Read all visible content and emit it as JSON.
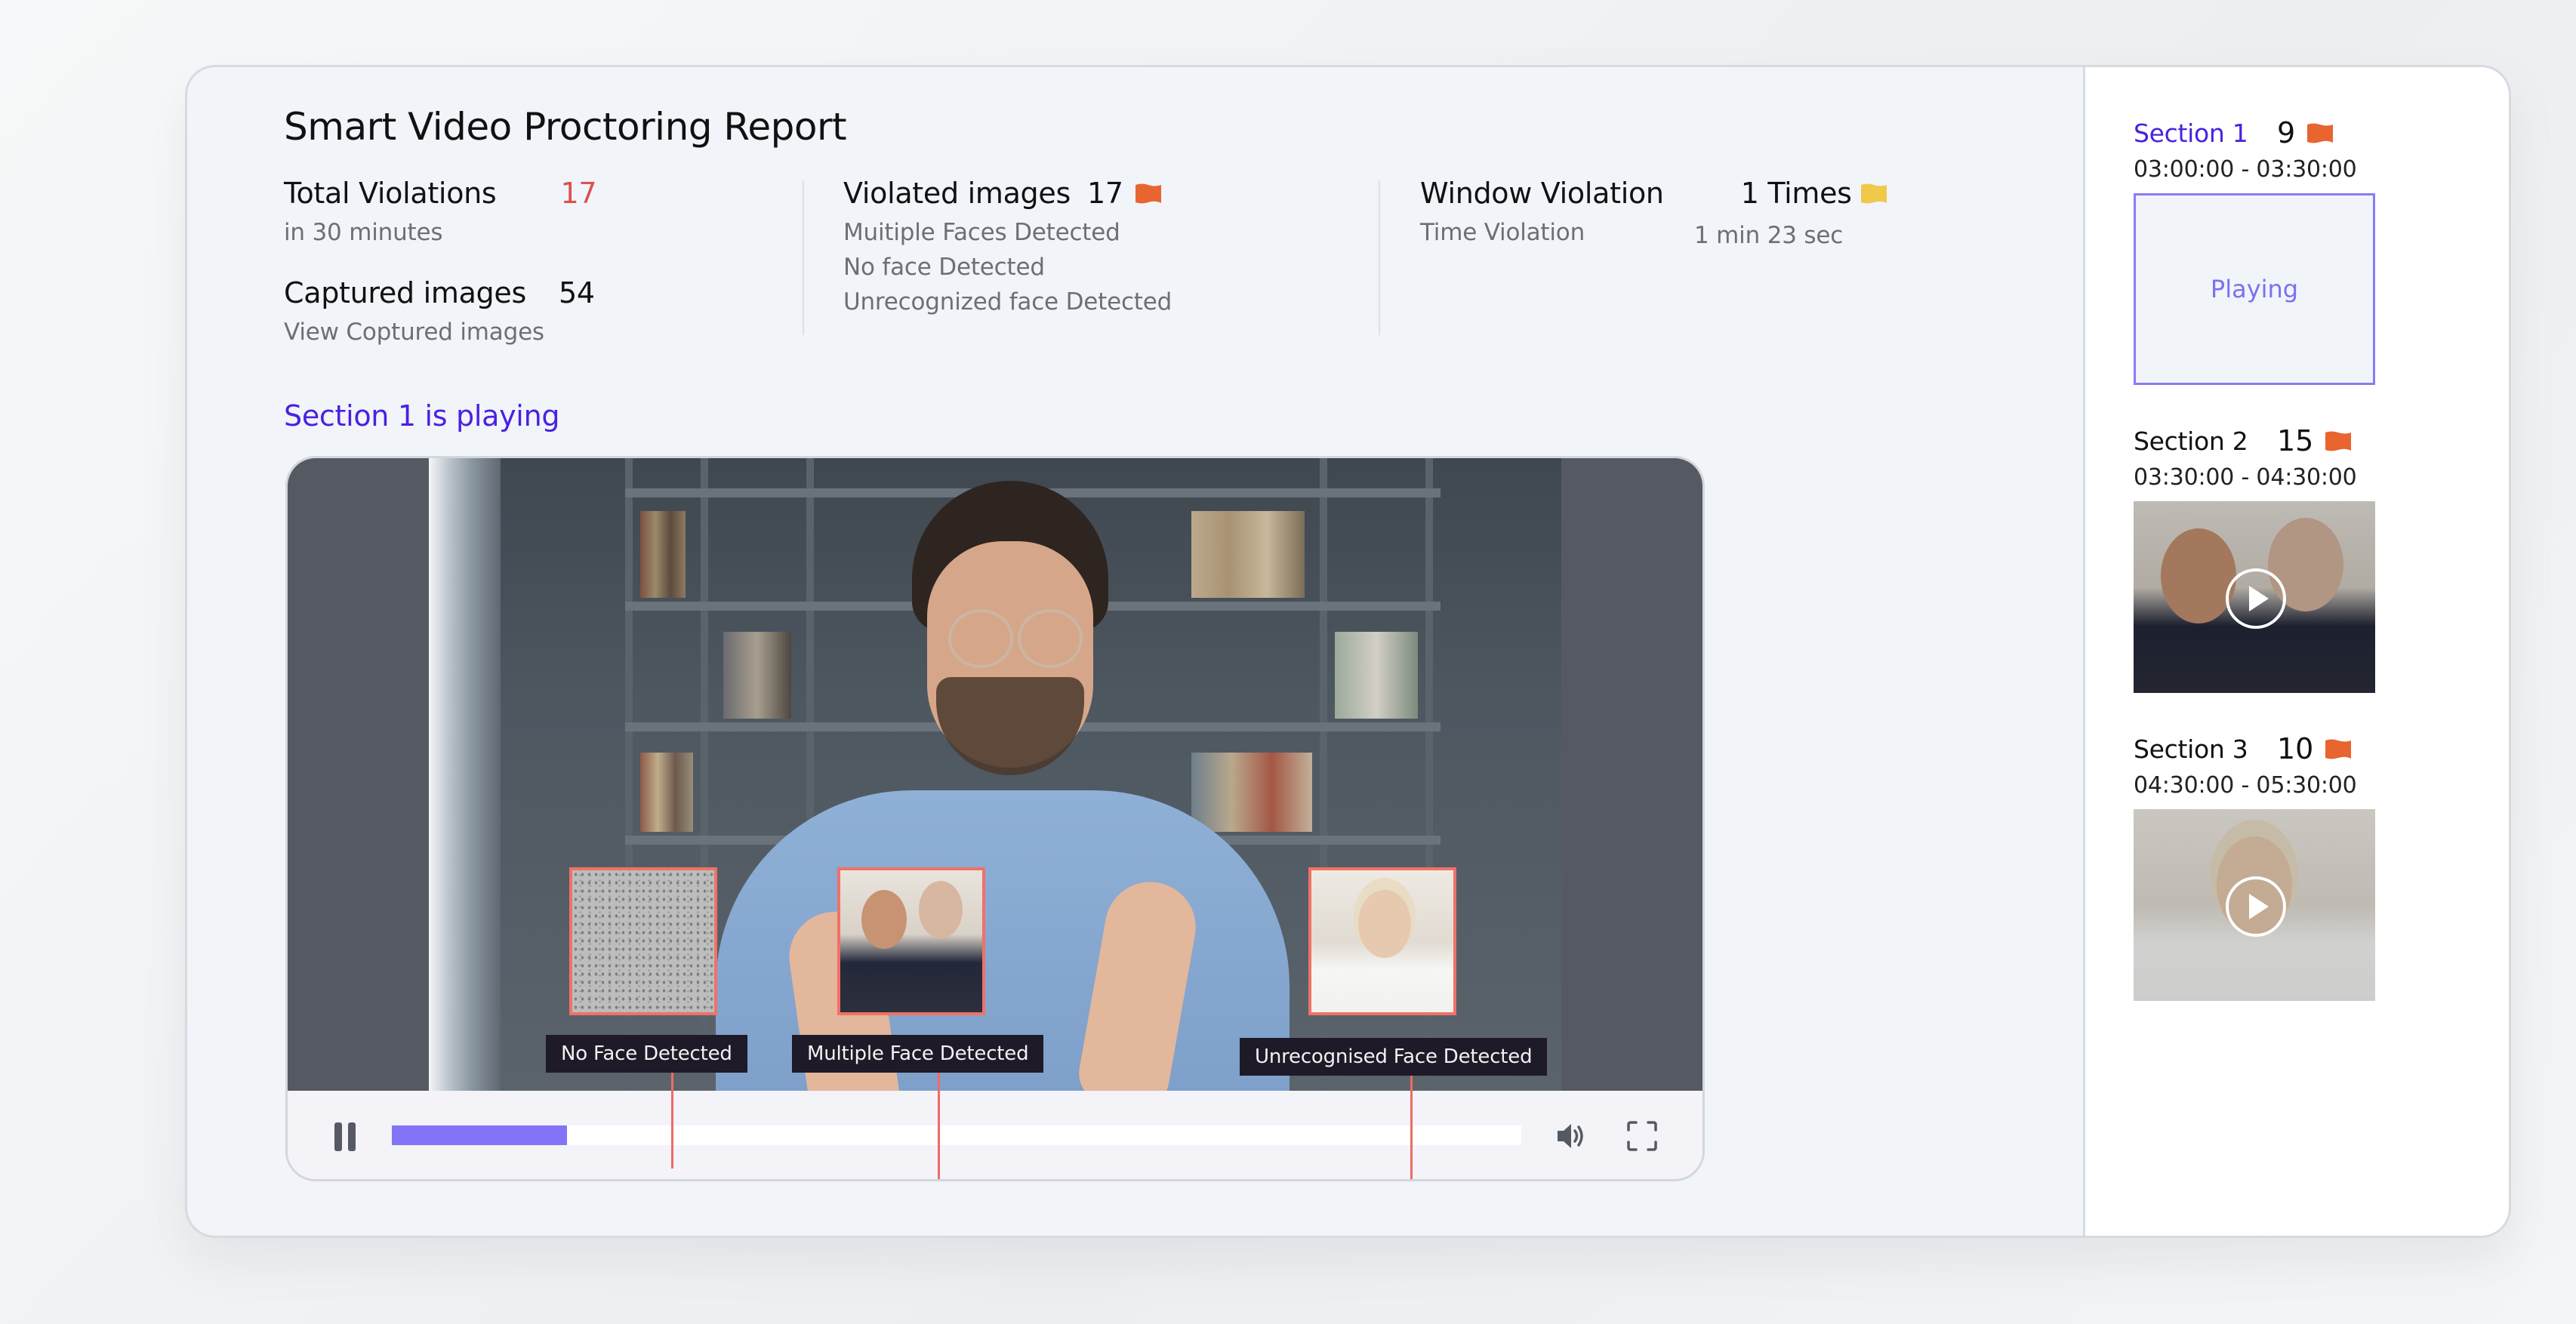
{
  "report": {
    "title": "Smart Video Proctoring Report",
    "total_violations": {
      "label": "Total Violations",
      "value": "17",
      "sub": "in 30 minutes"
    },
    "captured_images": {
      "label": "Captured images",
      "value": "54",
      "link": "View Coptured images"
    },
    "violated_images": {
      "label": "Violated images",
      "value": "17",
      "flag": "flag-icon",
      "flag_color": "#e8652f",
      "items": [
        "Muitiple Faces Detected",
        "No face Detected",
        "Unrecognized face Detected"
      ]
    },
    "window_violation": {
      "label": "Window Violation",
      "value": "1 Times",
      "flag": "flag-icon",
      "flag_color": "#f0c84a",
      "sub_label": "Time Violation",
      "sub_value": "1 min 23 sec"
    }
  },
  "player": {
    "now_playing": "Section 1 is playing",
    "progress_percent": 15.5,
    "captures": [
      {
        "label": "No Face Detected",
        "marker_percent": 24.7,
        "type": "no-face"
      },
      {
        "label": "Multiple Face Detected",
        "marker_percent": 48.3,
        "type": "multiple-faces"
      },
      {
        "label": "Unrecognised Face Detected",
        "marker_percent": 90.2,
        "type": "unrecognised-face"
      }
    ],
    "controls": {
      "pause": "pause-icon",
      "volume": "volume-icon",
      "fullscreen": "fullscreen-icon"
    },
    "colors": {
      "progress": "#8273f7",
      "marker": "#ef6b63"
    }
  },
  "sections": [
    {
      "name": "Section 1",
      "count": "9",
      "time": "03:00:00 - 03:30:00",
      "state": "Playing",
      "active": true
    },
    {
      "name": "Section 2",
      "count": "15",
      "time": "03:30:00 - 04:30:00",
      "state": "",
      "active": false
    },
    {
      "name": "Section 3",
      "count": "10",
      "time": "04:30:00 - 05:30:00",
      "state": "",
      "active": false
    }
  ],
  "colors": {
    "accent": "#4a21e0",
    "danger": "#d9534f",
    "flag_orange": "#e8652f",
    "flag_yellow": "#f0c84a"
  }
}
